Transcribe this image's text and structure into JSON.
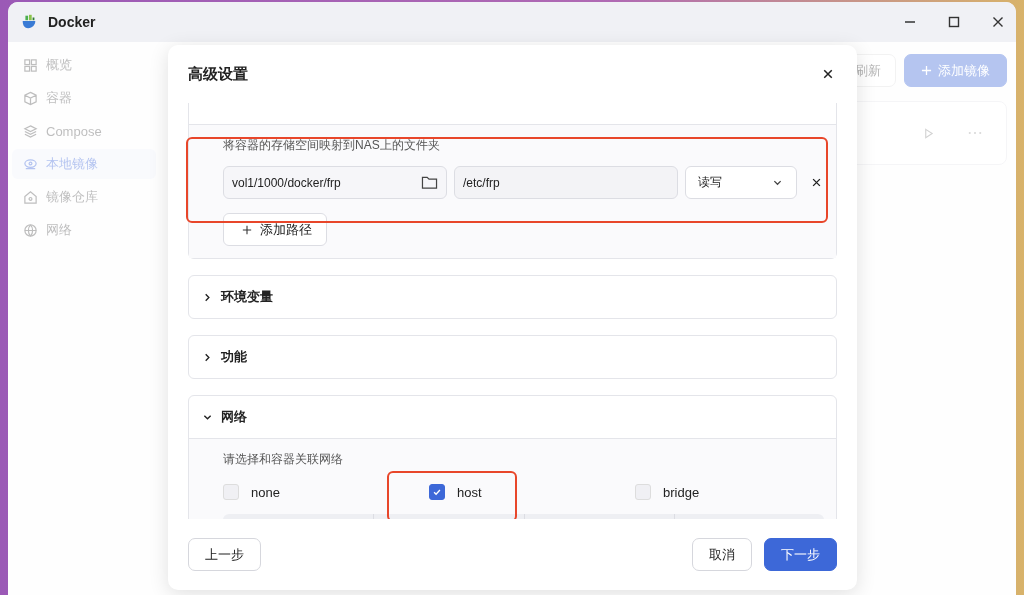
{
  "window": {
    "title": "Docker"
  },
  "sidebar": {
    "items": [
      {
        "label": "概览",
        "selected": false
      },
      {
        "label": "容器",
        "selected": false
      },
      {
        "label": "Compose",
        "selected": false
      },
      {
        "label": "本地镜像",
        "selected": true
      },
      {
        "label": "镜像仓库",
        "selected": false
      },
      {
        "label": "网络",
        "selected": false
      }
    ]
  },
  "toolbar": {
    "refresh": "刷新",
    "add": "添加镜像"
  },
  "dialog": {
    "title": "高级设置",
    "sections": [
      {
        "kind": "storage",
        "expanded": true,
        "description": "将容器的存储空间映射到NAS上的文件夹",
        "mappings": [
          {
            "host_path": "vol1/1000/docker/frp",
            "container_path": "/etc/frp",
            "mode": "读写"
          }
        ],
        "add_button": "添加路径"
      },
      {
        "title": "环境变量",
        "expanded": false
      },
      {
        "title": "功能",
        "expanded": false
      },
      {
        "kind": "network",
        "title": "网络",
        "expanded": true,
        "description": "请选择和容器关联网络",
        "options": [
          {
            "label": "none",
            "checked": false
          },
          {
            "label": "host",
            "checked": true
          },
          {
            "label": "bridge",
            "checked": false
          }
        ]
      }
    ],
    "back": "上一步",
    "cancel": "取消",
    "next": "下一步"
  }
}
